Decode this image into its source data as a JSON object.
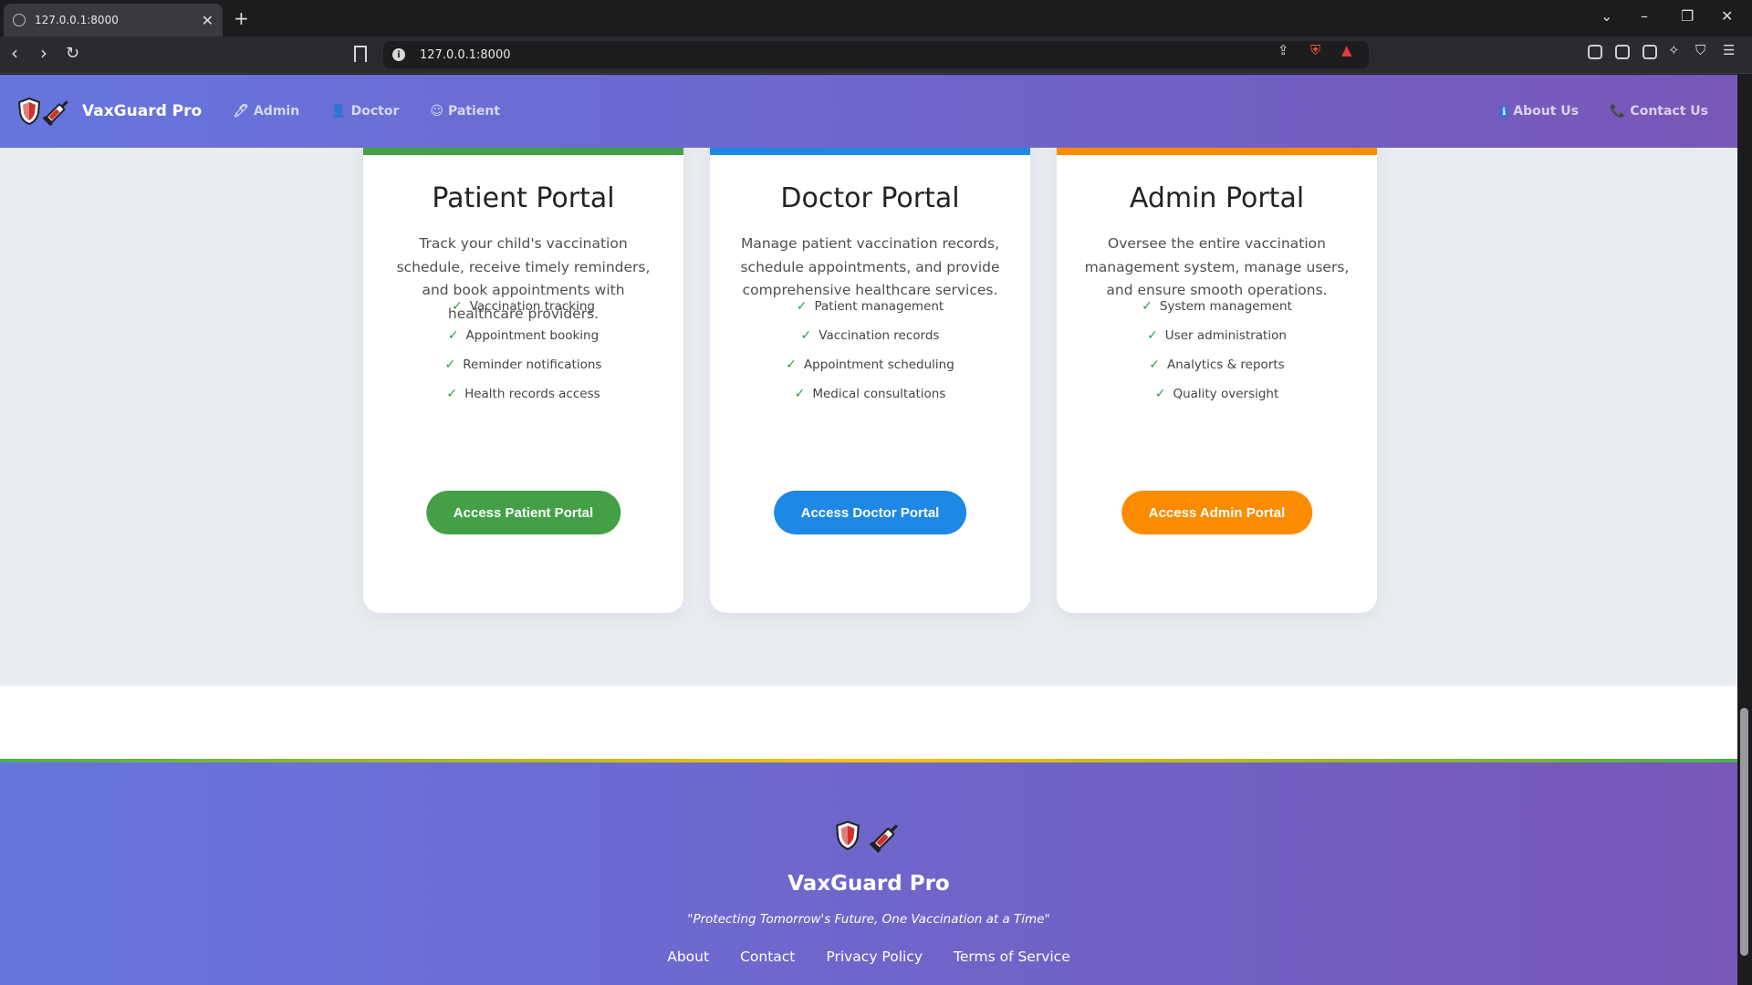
{
  "browser": {
    "tab_title": "127.0.0.1:8000",
    "tab_close": "✕",
    "new_tab": "+",
    "url": "127.0.0.1:8000",
    "win_min": "–",
    "win_restore": "❐",
    "win_close": "✕",
    "tab_search": "⌄"
  },
  "nav": {
    "brand": "VaxGuard Pro",
    "left_links": [
      {
        "icon": "syringe-icon",
        "glyph": "🖊",
        "label": "Admin"
      },
      {
        "icon": "doctor-icon",
        "glyph": "👤",
        "label": "Doctor"
      },
      {
        "icon": "patient-icon",
        "glyph": "☺",
        "label": "Patient"
      }
    ],
    "right_links": [
      {
        "icon": "info-icon",
        "glyph": "ℹ",
        "label": "About Us"
      },
      {
        "icon": "phone-icon",
        "glyph": "📞",
        "label": "Contact Us"
      }
    ]
  },
  "portals": [
    {
      "title": "Patient Portal",
      "description": "Track your child's vaccination schedule, receive timely reminders, and book appointments with healthcare providers.",
      "features": [
        "Vaccination tracking",
        "Appointment booking",
        "Reminder notifications",
        "Health records access"
      ],
      "button": "Access Patient Portal",
      "accent": "#43a047"
    },
    {
      "title": "Doctor Portal",
      "description": "Manage patient vaccination records, schedule appointments, and provide comprehensive healthcare services.",
      "features": [
        "Patient management",
        "Vaccination records",
        "Appointment scheduling",
        "Medical consultations"
      ],
      "button": "Access Doctor Portal",
      "accent": "#1e88e5"
    },
    {
      "title": "Admin Portal",
      "description": "Oversee the entire vaccination management system, manage users, and ensure smooth operations.",
      "features": [
        "System management",
        "User administration",
        "Analytics & reports",
        "Quality oversight"
      ],
      "button": "Access Admin Portal",
      "accent": "#fb8c00"
    }
  ],
  "check_glyph": "✓",
  "footer": {
    "name": "VaxGuard Pro",
    "tagline": "\"Protecting Tomorrow's Future, One Vaccination at a Time\"",
    "links": [
      "About",
      "Contact",
      "Privacy Policy",
      "Terms of Service"
    ]
  },
  "colors": {
    "header_gradient_start": "#6675de",
    "header_gradient_end": "#7757b8",
    "section_bg": "#e9ecf1"
  }
}
